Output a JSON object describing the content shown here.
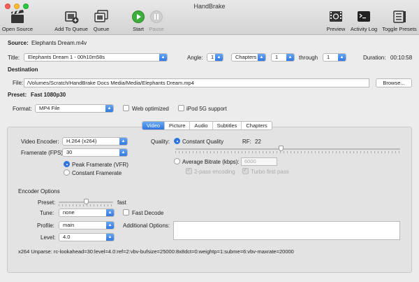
{
  "window": {
    "title": "HandBrake"
  },
  "toolbar": {
    "open_source": "Open Source",
    "add_to_queue": "Add To Queue",
    "queue": "Queue",
    "start": "Start",
    "pause": "Pause",
    "preview": "Preview",
    "activity_log": "Activity Log",
    "toggle_presets": "Toggle Presets"
  },
  "source": {
    "label": "Source:",
    "value": "Elephants Dream.m4v"
  },
  "title_row": {
    "label": "Title:",
    "title_value": "Elephants Dream 1 - 00h10m58s",
    "angle_label": "Angle:",
    "angle_value": "1",
    "range_type": "Chapters",
    "range_start": "1",
    "through_label": "through",
    "range_end": "1",
    "duration_label": "Duration:",
    "duration_value": "00:10:58"
  },
  "destination": {
    "heading": "Destination",
    "file_label": "File:",
    "file_path": "/Volumes/Scratch/HandBrake Docs Media/Media/Elephants Dream.mp4",
    "browse_label": "Browse..."
  },
  "preset": {
    "label": "Preset:",
    "value": "Fast 1080p30"
  },
  "format": {
    "label": "Format:",
    "value": "MP4 File",
    "web_optimized": "Web optimized",
    "ipod": "iPod 5G support"
  },
  "tabs": [
    "Video",
    "Picture",
    "Audio",
    "Subtitles",
    "Chapters"
  ],
  "video": {
    "encoder_label": "Video Encoder:",
    "encoder_value": "H.264 (x264)",
    "framerate_label": "Framerate (FPS):",
    "framerate_value": "30",
    "peak_framerate": "Peak Framerate (VFR)",
    "constant_framerate": "Constant Framerate",
    "quality_label": "Quality:",
    "constant_quality": "Constant Quality",
    "rf_label": "RF:",
    "rf_value": "22",
    "rf_slider_fraction": 0.47,
    "average_bitrate": "Average Bitrate (kbps):",
    "bitrate_value": "6000",
    "two_pass": "2-pass encoding",
    "turbo_first_pass": "Turbo first pass"
  },
  "encoder_options": {
    "heading": "Encoder Options",
    "preset_label": "Preset:",
    "preset_right": "fast",
    "preset_slider_fraction": 0.5,
    "tune_label": "Tune:",
    "tune_value": "none",
    "fast_decode": "Fast Decode",
    "profile_label": "Profile:",
    "profile_value": "main",
    "additional_label": "Additional Options:",
    "level_label": "Level:",
    "level_value": "4.0",
    "unparse": "x264 Unparse: rc-lookahead=30:level=4.0:ref=2:vbv-bufsize=25000:8x8dct=0:weightp=1:subme=6:vbv-maxrate=20000"
  }
}
